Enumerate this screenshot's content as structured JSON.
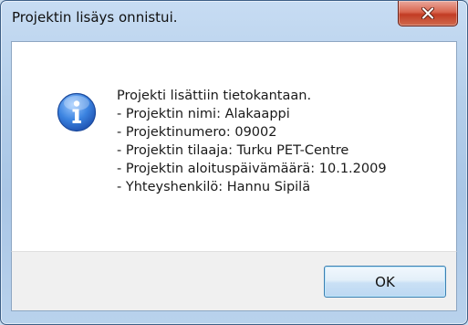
{
  "window": {
    "title": "Projektin lisäys onnistui."
  },
  "dialog": {
    "icon": "info-icon",
    "message_lines": [
      "Projekti lisättiin tietokantaan.",
      "- Projektin nimi: Alakaappi",
      "- Projektinumero: 09002",
      "- Projektin tilaaja: Turku PET-Centre",
      "- Projektin aloituspäivämäärä: 10.1.2009",
      "- Yhteyshenkilö: Hannu Sipilä"
    ],
    "ok_label": "OK"
  },
  "colors": {
    "close_button": "#c94a30",
    "info_icon": "#2a6ed1",
    "ok_border": "#3c7fb1"
  }
}
